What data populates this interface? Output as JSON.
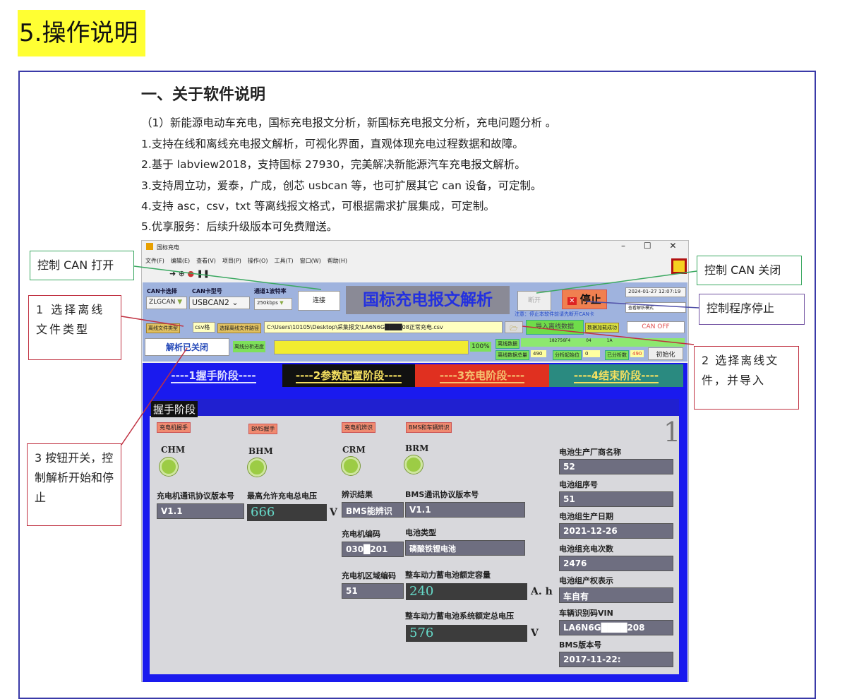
{
  "section_title": "5.操作说明",
  "doc": {
    "heading": "一、关于软件说明",
    "lines": [
      "（1）新能源电动车充电，国标充电报文分析，新国标充电报文分析，充电问题分析 。",
      "1.支持在线和离线充电报文解析，可视化界面，直观体现充电过程数据和故障。",
      "2.基于 labview2018，支持国标 27930，完美解决新能源汽车充电报文解析。",
      "3.支持周立功，爱泰，广成，创芯 usbcan 等，也可扩展其它 can 设备，可定制。",
      "4.支持 asc，csv，txt 等离线报文格式，可根据需求扩展集成，可定制。",
      "5.优享服务：后续升级版本可免费赠送。"
    ]
  },
  "callouts": {
    "can_open": "控制 CAN 打开",
    "file_type": "1 选择离线文件类型",
    "toggle": "3 按钮开关，控制解析开始和停止",
    "can_close": "控制 CAN 关闭",
    "stop": "控制程序停止",
    "import": "2 选择离线文件，并导入"
  },
  "app": {
    "title": "国标充电",
    "menu": [
      "文件(F)",
      "编辑(E)",
      "查看(V)",
      "项目(P)",
      "操作(O)",
      "工具(T)",
      "窗口(W)",
      "帮助(H)"
    ],
    "can_select_label": "CAN卡选择",
    "can_select": "ZLGCAN",
    "can_model_label": "CAN卡型号",
    "can_model": "USBCAN2",
    "baud_label": "通道1波特率",
    "baud": "250kbps",
    "connect": "连接",
    "banner": "国标充电报文解析",
    "disconnect": "断开",
    "stop": "停止",
    "datetime": "2024-01-27 12:07:19",
    "note": "注意：停止本软件前请先断开CAN卡",
    "mode_btn": "查看解析模式",
    "file_type_label": "离线文件类型",
    "file_type": "csv格",
    "file_path_label": "选择离线文件路径",
    "file_path": "C:\\Users\\10105\\Desktop\\采集报文\\LA6N6G████08正常充电.csv",
    "import_btn": "导入离线数据",
    "load_status": "数据加载成功",
    "can_status": "CAN OFF",
    "parse_toggle": "解析已关闭",
    "progress_label": "离线分析进度",
    "progress": 100,
    "progress_text": "100%",
    "offline_data_label": "离线数据",
    "offline_id": "182756F4",
    "offline_bytes": "04 1A",
    "total_label": "离线数据总量",
    "total": "490",
    "start_label": "分析起始位",
    "start": "0",
    "done_label": "已分析数",
    "done": "490",
    "init_btn": "初始化",
    "tabs": [
      "----1握手阶段----",
      "----2参数配置阶段----",
      "----3充电阶段----",
      "----4结束阶段----"
    ],
    "panel_title": "握手阶段",
    "tags": [
      "充电机握手",
      "BMS握手",
      "充电机辨识",
      "BMS和车辆辨识"
    ],
    "page_no": "1",
    "leds": [
      "CHM",
      "BHM",
      "CRM",
      "BRM"
    ],
    "fields": {
      "charger_proto_label": "充电机通讯协议版本号",
      "charger_proto": "V1.1",
      "max_volt_label": "最高允许充电总电压",
      "max_volt": "666",
      "v": "V",
      "ident_label": "辨识结果",
      "ident": "BMS能辨识",
      "bms_proto_label": "BMS通讯协议版本号",
      "bms_proto": "V1.1",
      "charger_code_label": "充电机编码",
      "charger_code": "030█201",
      "battery_type_label": "电池类型",
      "battery_type": "磷酸铁锂电池",
      "region_label": "充电机区域编码",
      "region": "51",
      "capacity_label": "整车动力蓄电池额定容量",
      "capacity": "240",
      "ah": "A. h",
      "rated_volt_label": "整车动力蓄电池系统额定总电压",
      "rated_volt": "576"
    },
    "right": [
      {
        "label": "电池生产厂商名称",
        "value": "52"
      },
      {
        "label": "电池组序号",
        "value": "51"
      },
      {
        "label": "电池组生产日期",
        "value": "2021-12-26"
      },
      {
        "label": "电池组充电次数",
        "value": "2476"
      },
      {
        "label": "电池组产权表示",
        "value": "车自有"
      },
      {
        "label": "车辆识别码VIN",
        "value": "LA6N6G████208"
      },
      {
        "label": "BMS版本号",
        "value": "2017-11-22:"
      }
    ]
  }
}
